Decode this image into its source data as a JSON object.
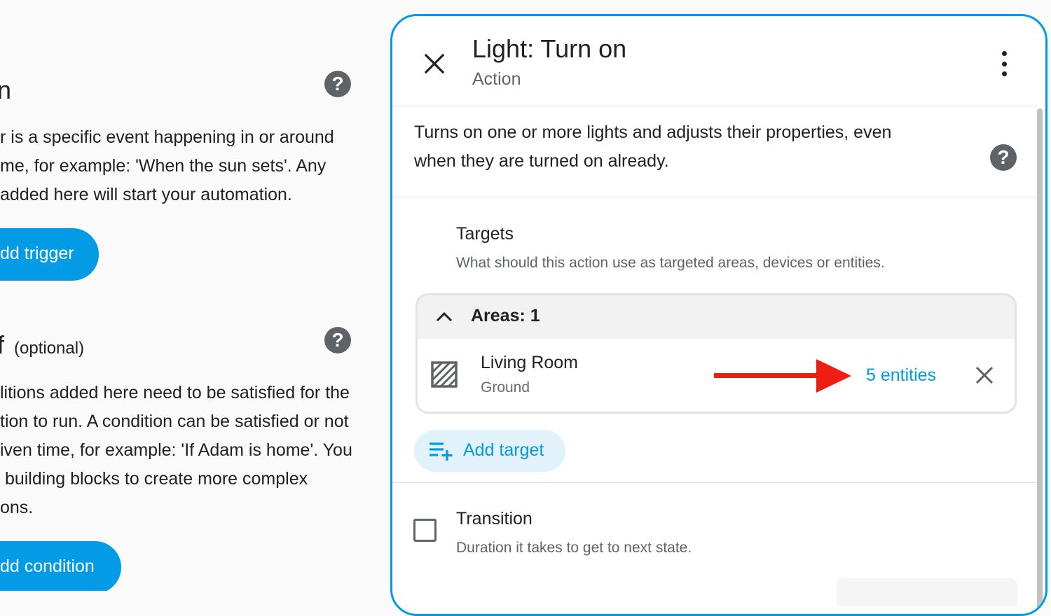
{
  "left_panel": {
    "triggers": {
      "title": "n",
      "description_lines": [
        "r is a specific event happening in or around",
        "me, for example: 'When the sun sets'. Any",
        "added here will start your automation."
      ],
      "button_label": "dd trigger"
    },
    "conditions": {
      "title": "f",
      "optional": "(optional)",
      "description_lines": [
        "litions added here need to be satisfied for the",
        "tion to run. A condition can be satisfied or not",
        "iven time, for example: 'If Adam is home'. You",
        " building blocks to create more complex",
        "ons."
      ],
      "button_label": "dd condition"
    },
    "help_icon_glyph": "?"
  },
  "dialog": {
    "title": "Light: Turn on",
    "subtitle": "Action",
    "description_lines": [
      "Turns on one or more lights and adjusts their properties, even",
      "when they are turned on already."
    ],
    "help_icon_glyph": "?",
    "targets": {
      "label": "Targets",
      "description": "What should this action use as targeted areas, devices or entities.",
      "areas_header": "Areas: 1",
      "items": [
        {
          "name": "Living Room",
          "floor": "Ground",
          "entities_link": "5 entities"
        }
      ],
      "add_target_label": "Add target"
    },
    "transition": {
      "label": "Transition",
      "description": "Duration it takes to get to next state.",
      "checked": false
    }
  },
  "colors": {
    "accent": "#039be5",
    "accent_light": "#e1f2fb",
    "annotation_arrow": "#f01e12",
    "help_icon_bg": "#5f6368"
  }
}
